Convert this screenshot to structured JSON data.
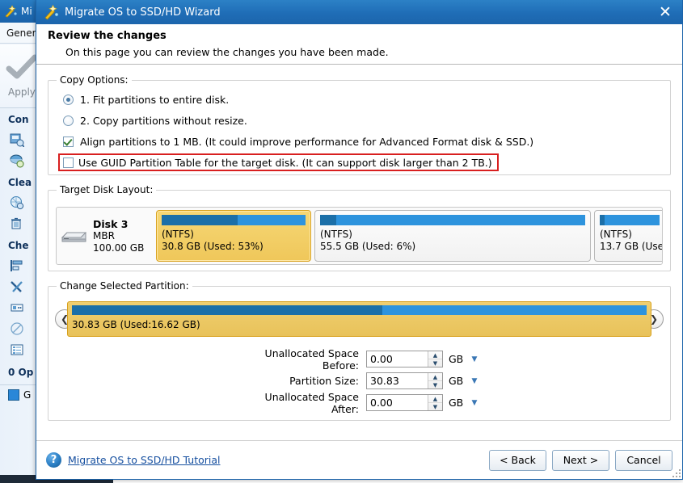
{
  "background_app": {
    "title": "Mi",
    "menu_item": "Gener",
    "toolbar": {
      "apply_label": "Apply",
      "apply_icon": "checkmark-icon"
    },
    "sidebar": [
      {
        "type": "group",
        "label": "Con"
      },
      {
        "type": "item",
        "icon": "disk-copy-icon",
        "label": ""
      },
      {
        "type": "item",
        "icon": "partition-copy-icon",
        "label": ""
      },
      {
        "type": "group",
        "label": "Clea"
      },
      {
        "type": "item",
        "icon": "wipe-disk-icon",
        "label": ""
      },
      {
        "type": "item",
        "icon": "trash-wipe-icon",
        "label": ""
      },
      {
        "type": "group",
        "label": "Che"
      },
      {
        "type": "item",
        "icon": "align-partition-icon",
        "label": ""
      },
      {
        "type": "item",
        "icon": "tools-icon",
        "label": ""
      },
      {
        "type": "item",
        "icon": "surface-test-icon",
        "label": ""
      },
      {
        "type": "item",
        "icon": "disable-icon",
        "label": ""
      },
      {
        "type": "item",
        "icon": "properties-list-icon",
        "label": ""
      }
    ],
    "operations_count": "0 Op",
    "footer_check": {
      "label": "G",
      "icon": "blue-square-icon"
    }
  },
  "dialog": {
    "title": "Migrate OS to SSD/HD Wizard",
    "title_icon": "wizard-wand-icon",
    "close_icon": "close-icon",
    "close_label": "✕",
    "header": {
      "heading": "Review the changes",
      "subheading": "On this page you can review the changes you have been made."
    },
    "copy_options": {
      "legend": "Copy Options:",
      "radios": [
        {
          "label": "1. Fit partitions to entire disk.",
          "checked": true
        },
        {
          "label": "2. Copy partitions without resize.",
          "checked": false
        }
      ],
      "checkboxes": [
        {
          "label": "Align partitions to 1 MB.  (It could improve performance for Advanced Format disk & SSD.)",
          "checked": true,
          "highlighted": false
        },
        {
          "label": "Use GUID Partition Table for the target disk. (It can support disk larger than 2 TB.)",
          "checked": false,
          "highlighted": true
        }
      ],
      "highlight_color": "#d81f1f"
    },
    "target_disk_layout": {
      "legend": "Target Disk Layout:",
      "disk": {
        "name": "Disk 3",
        "scheme": "MBR",
        "capacity": "100.00 GB",
        "icon": "hard-disk-icon"
      },
      "partitions": [
        {
          "fs": "(NTFS)",
          "size_label": "30.8 GB (Used: 53%)",
          "used_pct": 53,
          "selected": true,
          "width_pct": 31.5
        },
        {
          "fs": "(NTFS)",
          "size_label": "55.5 GB (Used: 6%)",
          "used_pct": 6,
          "selected": false,
          "width_pct": 54.5
        },
        {
          "fs": "(NTFS)",
          "size_label": "13.7 GB (Use",
          "used_pct": 8,
          "selected": false,
          "width_pct": 14.0
        }
      ]
    },
    "change_selected_partition": {
      "legend": "Change Selected Partition:",
      "prev_icon": "chevron-left-icon",
      "next_icon": "chevron-right-icon",
      "prev_label": "❮",
      "next_label": "❯",
      "bar_label": "30.83 GB (Used:16.62 GB)",
      "bar_used_pct": 54,
      "fields": [
        {
          "label": "Unallocated Space Before:",
          "value": "0.00",
          "unit": "GB"
        },
        {
          "label": "Partition Size:",
          "value": "30.83",
          "unit": "GB"
        },
        {
          "label": "Unallocated Space After:",
          "value": "0.00",
          "unit": "GB"
        }
      ],
      "unit_dropdown_icon": "chevron-down-icon",
      "unit_dropdown_label": "▼",
      "spinner_up_label": "▲",
      "spinner_down_label": "▼"
    },
    "footer": {
      "help_icon": "help-question-icon",
      "help_label": "?",
      "tutorial_link": "Migrate OS to SSD/HD Tutorial",
      "buttons": [
        {
          "label": "< Back",
          "name": "back-button"
        },
        {
          "label": "Next >",
          "name": "next-button"
        },
        {
          "label": "Cancel",
          "name": "cancel-button"
        }
      ]
    }
  },
  "colors": {
    "titlebar": "#1f6db6",
    "selected_partition": "#efc75a",
    "used_space": "#1b6fa8",
    "free_space": "#2d93dd",
    "highlight_box": "#d81f1f",
    "link": "#1750a0"
  }
}
